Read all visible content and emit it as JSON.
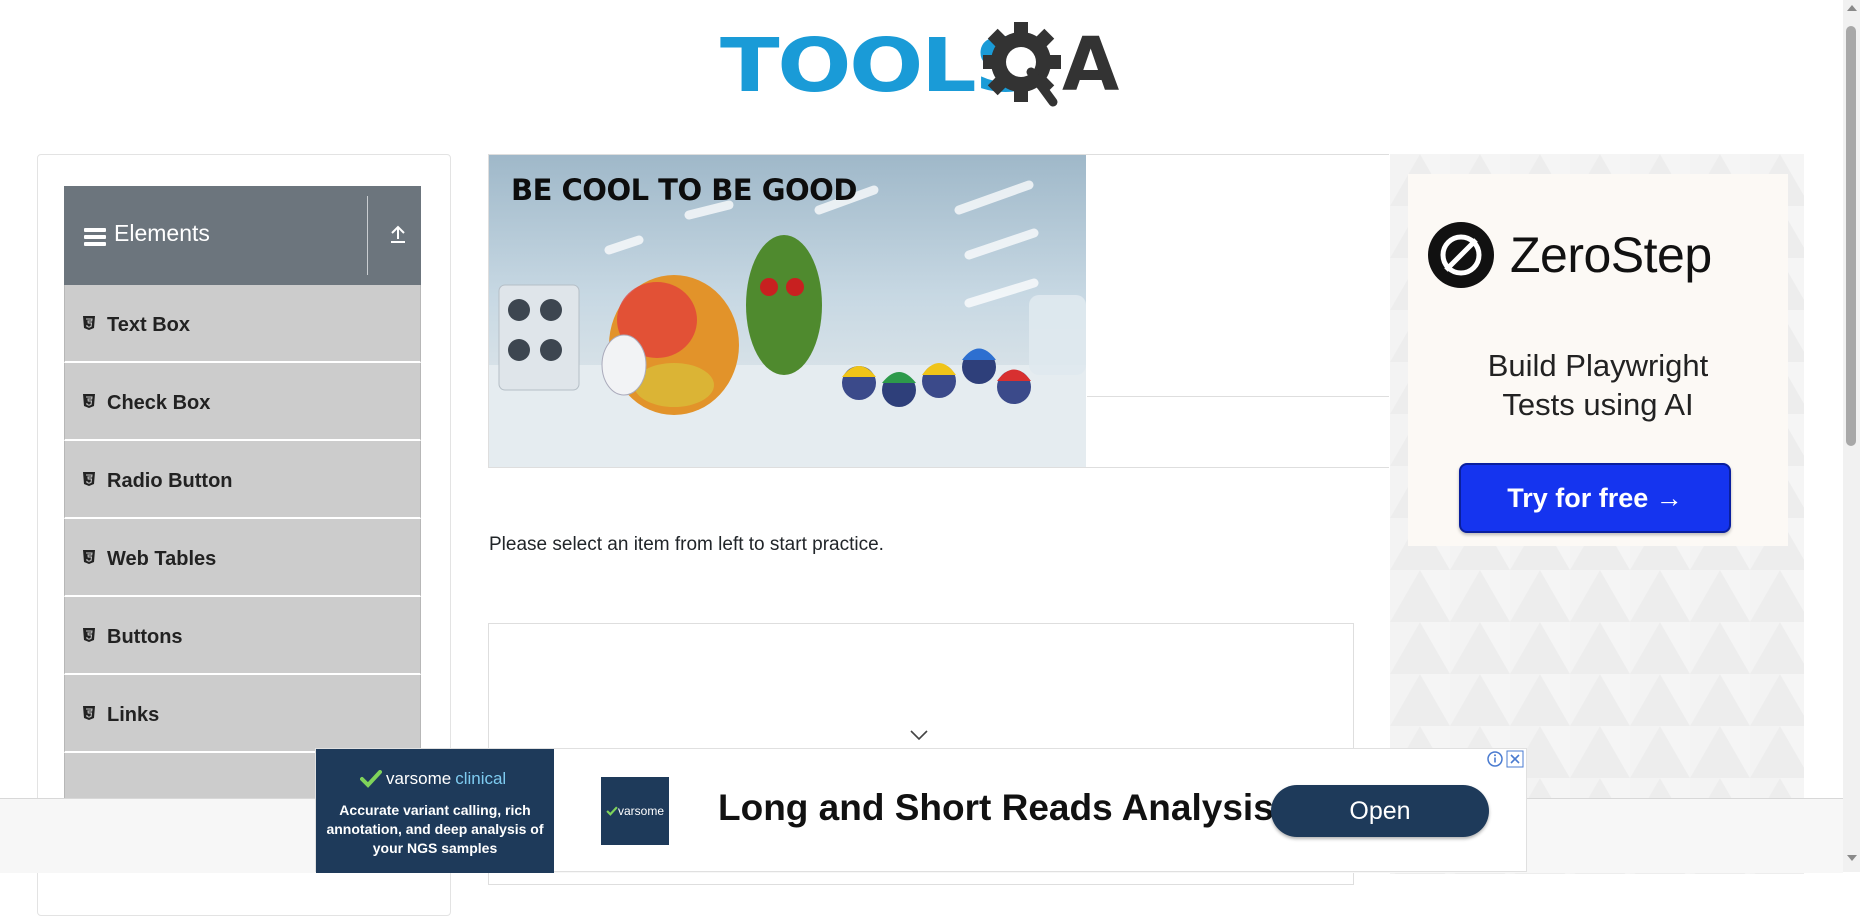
{
  "header": {
    "logo_text": "TOOLS",
    "logo_suffix": "A"
  },
  "sidebar": {
    "group_title": "Elements",
    "items": [
      {
        "label": "Text Box"
      },
      {
        "label": "Check Box"
      },
      {
        "label": "Radio Button"
      },
      {
        "label": "Web Tables"
      },
      {
        "label": "Buttons"
      },
      {
        "label": "Links"
      }
    ]
  },
  "banner": {
    "headline": "BE COOL TO BE GOOD"
  },
  "main": {
    "instruction": "Please select an item from left to start practice."
  },
  "right_ad": {
    "brand": "ZeroStep",
    "tagline_line1": "Build Playwright",
    "tagline_line2": "Tests using AI",
    "cta": "Try for free →"
  },
  "bottom_ad": {
    "brand_part1": "varsome",
    "brand_part2": "clinical",
    "description": "Accurate variant calling, rich annotation, and deep analysis of your NGS samples",
    "thumb_label": "varsome",
    "title": "Long and Short Reads Analysis",
    "button": "Open"
  },
  "colors": {
    "sidebar_header": "#6c757d",
    "menu_item": "#cccccc",
    "logo_blue": "#1a9bd7",
    "cta_blue": "#1534ef",
    "ad_navy": "#1e3a5a"
  }
}
